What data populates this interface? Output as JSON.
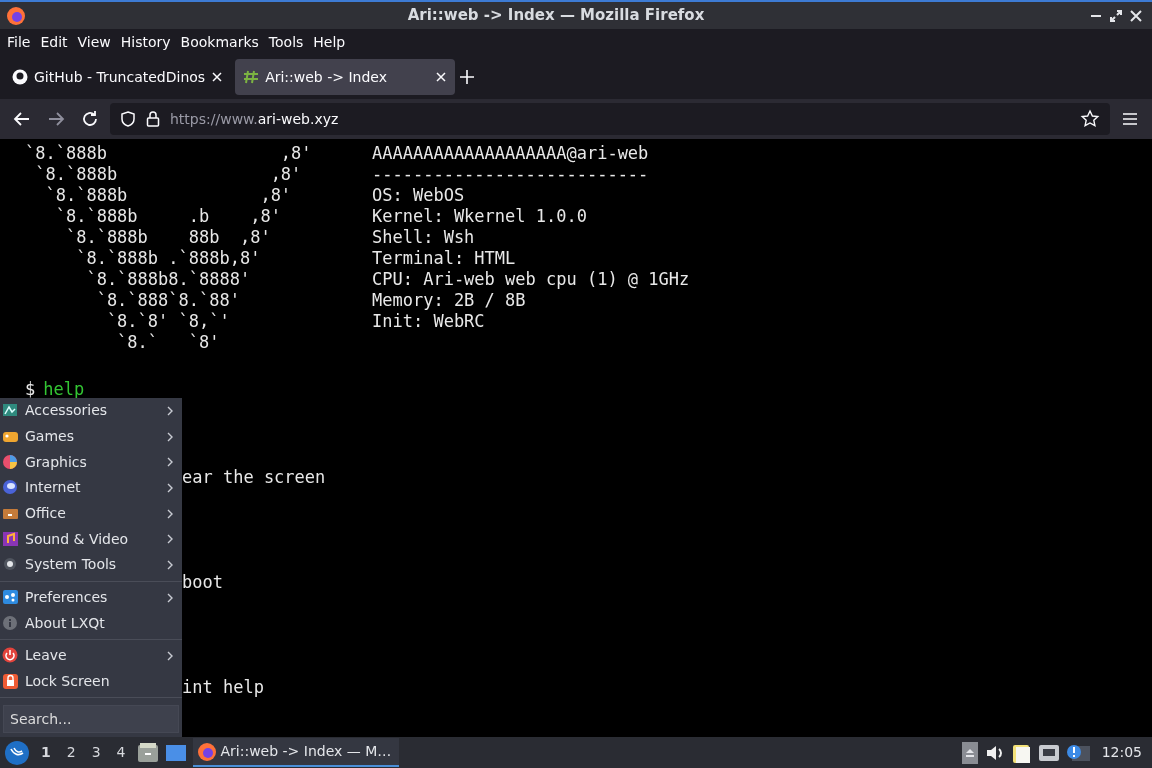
{
  "window": {
    "title": "Ari::web -> Index — Mozilla Firefox"
  },
  "menubar": [
    "File",
    "Edit",
    "View",
    "History",
    "Bookmarks",
    "Tools",
    "Help"
  ],
  "tabs": [
    {
      "label": "GitHub - TruncatedDinos",
      "selected": false
    },
    {
      "label": "Ari::web -> Index",
      "selected": true
    }
  ],
  "address_bar": {
    "scheme": "https://www.",
    "host": "ari-web.xyz"
  },
  "terminal": {
    "ascii_art": [
      "`8.`888b                 ,8'",
      " `8.`888b               ,8'",
      "  `8.`888b             ,8'",
      "   `8.`888b     .b    ,8'",
      "    `8.`888b    88b  ,8'",
      "     `8.`888b .`888b,8'",
      "      `8.`888b8.`8888'",
      "       `8.`888`8.`88'",
      "        `8.`8' `8,`'",
      "         `8.`   `8'"
    ],
    "info": [
      "AAAAAAAAAAAAAAAAAAA@ari-web",
      "---------------------------",
      "OS: WebOS",
      "Kernel: Wkernel 1.0.0",
      "Shell: Wsh",
      "Terminal: HTML",
      "CPU: Ari-web web cpu (1) @ 1GHz",
      "Memory: 2B / 8B",
      "Init: WebRC"
    ],
    "prompt": {
      "symbol": "$",
      "command": "help"
    },
    "output": [
      "ear the screen",
      "boot",
      "int help"
    ]
  },
  "start_menu": {
    "items": [
      {
        "label": "Accessories",
        "submenu": true,
        "separator_before": false
      },
      {
        "label": "Games",
        "submenu": true,
        "separator_before": false
      },
      {
        "label": "Graphics",
        "submenu": true,
        "separator_before": false
      },
      {
        "label": "Internet",
        "submenu": true,
        "separator_before": false
      },
      {
        "label": "Office",
        "submenu": true,
        "separator_before": false
      },
      {
        "label": "Sound & Video",
        "submenu": true,
        "separator_before": false
      },
      {
        "label": "System Tools",
        "submenu": true,
        "separator_before": false
      },
      {
        "label": "Preferences",
        "submenu": true,
        "separator_before": true
      },
      {
        "label": "About LXQt",
        "submenu": false,
        "separator_before": false
      },
      {
        "label": "Leave",
        "submenu": true,
        "separator_before": true
      },
      {
        "label": "Lock Screen",
        "submenu": false,
        "separator_before": false
      }
    ],
    "search": {
      "placeholder": "Search..."
    }
  },
  "taskbar": {
    "desktops": [
      {
        "label": "1",
        "selected": true
      },
      {
        "label": "2",
        "selected": false
      },
      {
        "label": "3",
        "selected": false
      },
      {
        "label": "4",
        "selected": false
      }
    ],
    "task": {
      "label": "Ari::web -> Index — M…",
      "selected": true
    },
    "clock": "12:05"
  }
}
